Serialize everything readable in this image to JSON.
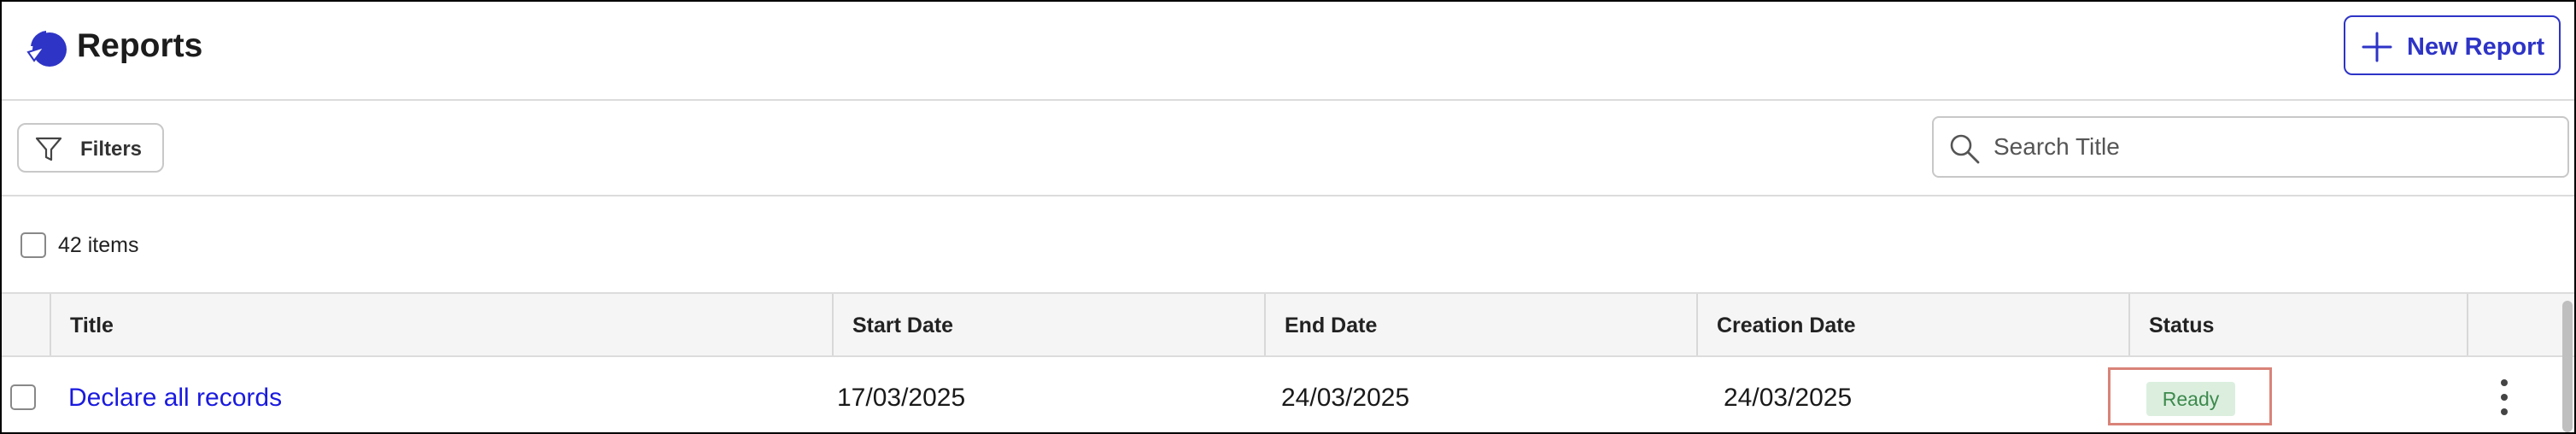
{
  "header": {
    "title": "Reports",
    "new_button_label": "New Report",
    "accent_color": "#2e34c6",
    "logo_icon": "pie-chart-icon"
  },
  "filterbar": {
    "filters_label": "Filters",
    "filters_icon": "funnel-icon",
    "search_placeholder": "Search Title",
    "search_value": "",
    "search_icon": "magnifier-icon"
  },
  "list": {
    "count_label": "42 items"
  },
  "table": {
    "columns": [
      "Title",
      "Start Date",
      "End Date",
      "Creation Date",
      "Status"
    ],
    "rows": [
      {
        "title": "Declare all records",
        "start_date": "17/03/2025",
        "end_date": "24/03/2025",
        "creation_date": "24/03/2025",
        "status": "Ready"
      }
    ],
    "link_color": "#1a1adf",
    "status_colors": {
      "ready_bg": "#dcefdf",
      "ready_text": "#3d8a4d",
      "highlight_border": "#d98378"
    }
  }
}
